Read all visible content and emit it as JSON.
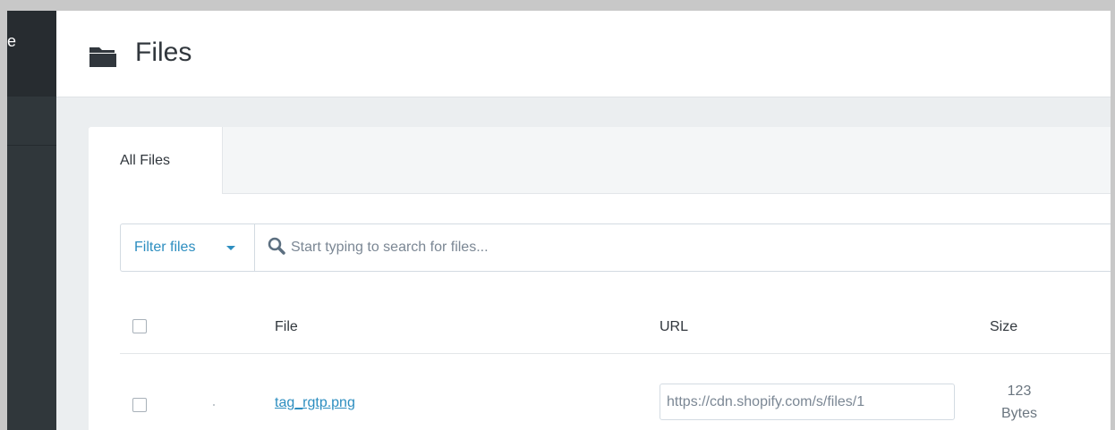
{
  "sidebar": {
    "top_label": "e"
  },
  "header": {
    "title": "Files",
    "icon": "folder-icon"
  },
  "tabs": [
    {
      "label": "All Files",
      "active": true
    }
  ],
  "filter": {
    "label": "Filter files"
  },
  "search": {
    "placeholder": "Start typing to search for files..."
  },
  "table": {
    "headers": {
      "file": "File",
      "url": "URL",
      "size": "Size"
    },
    "rows": [
      {
        "file": "tag_rgtp.png",
        "url": "https://cdn.shopify.com/s/files/1",
        "size_number": "123",
        "size_unit": "Bytes",
        "checked": false
      }
    ]
  },
  "colors": {
    "accent": "#2d8ec0",
    "sidebar": "#30373b",
    "text": "#31373d"
  }
}
